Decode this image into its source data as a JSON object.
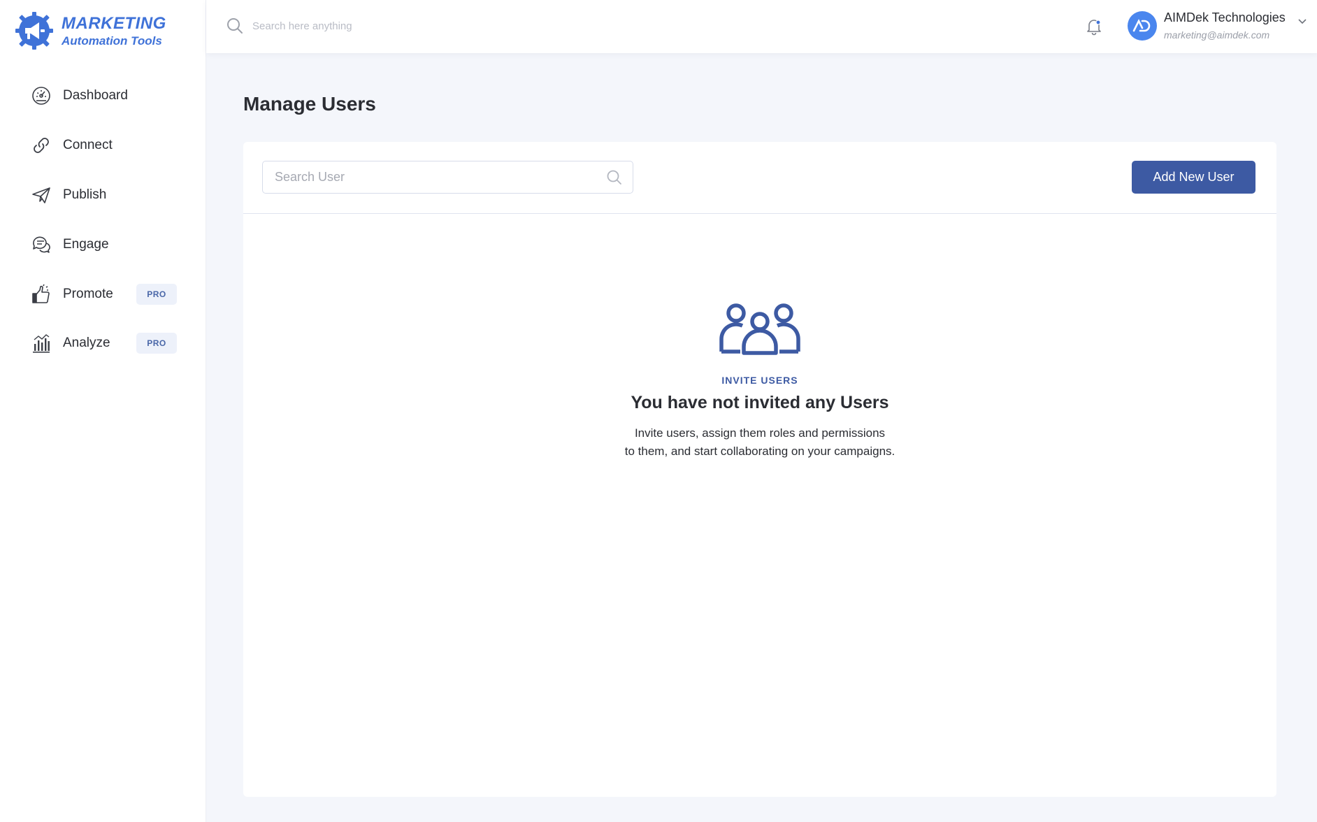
{
  "brand": {
    "title": "MARKETING",
    "subtitle": "Automation Tools",
    "accent": "#3f72d8"
  },
  "sidebar": {
    "items": [
      {
        "label": "Dashboard",
        "icon": "dashboard-gauge-icon"
      },
      {
        "label": "Connect",
        "icon": "link-icon"
      },
      {
        "label": "Publish",
        "icon": "paper-plane-icon"
      },
      {
        "label": "Engage",
        "icon": "chat-bubbles-icon"
      },
      {
        "label": "Promote",
        "icon": "thumbs-up-icon",
        "badge": "PRO"
      },
      {
        "label": "Analyze",
        "icon": "bar-chart-icon",
        "badge": "PRO"
      }
    ]
  },
  "topbar": {
    "search_placeholder": "Search here anything",
    "account_name": "AIMDek Technologies",
    "account_email": "marketing@aimdek.com",
    "notification_dot_color": "#3f72d8"
  },
  "main": {
    "page_title": "Manage Users",
    "search_placeholder": "Search User",
    "add_button_label": "Add New User",
    "button_color": "#3d5aa3",
    "empty_state": {
      "eyebrow": "INVITE USERS",
      "title": "You have not invited any Users",
      "description_line1": "Invite users, assign them roles and permissions",
      "description_line2": "to them, and start collaborating on your campaigns."
    }
  }
}
